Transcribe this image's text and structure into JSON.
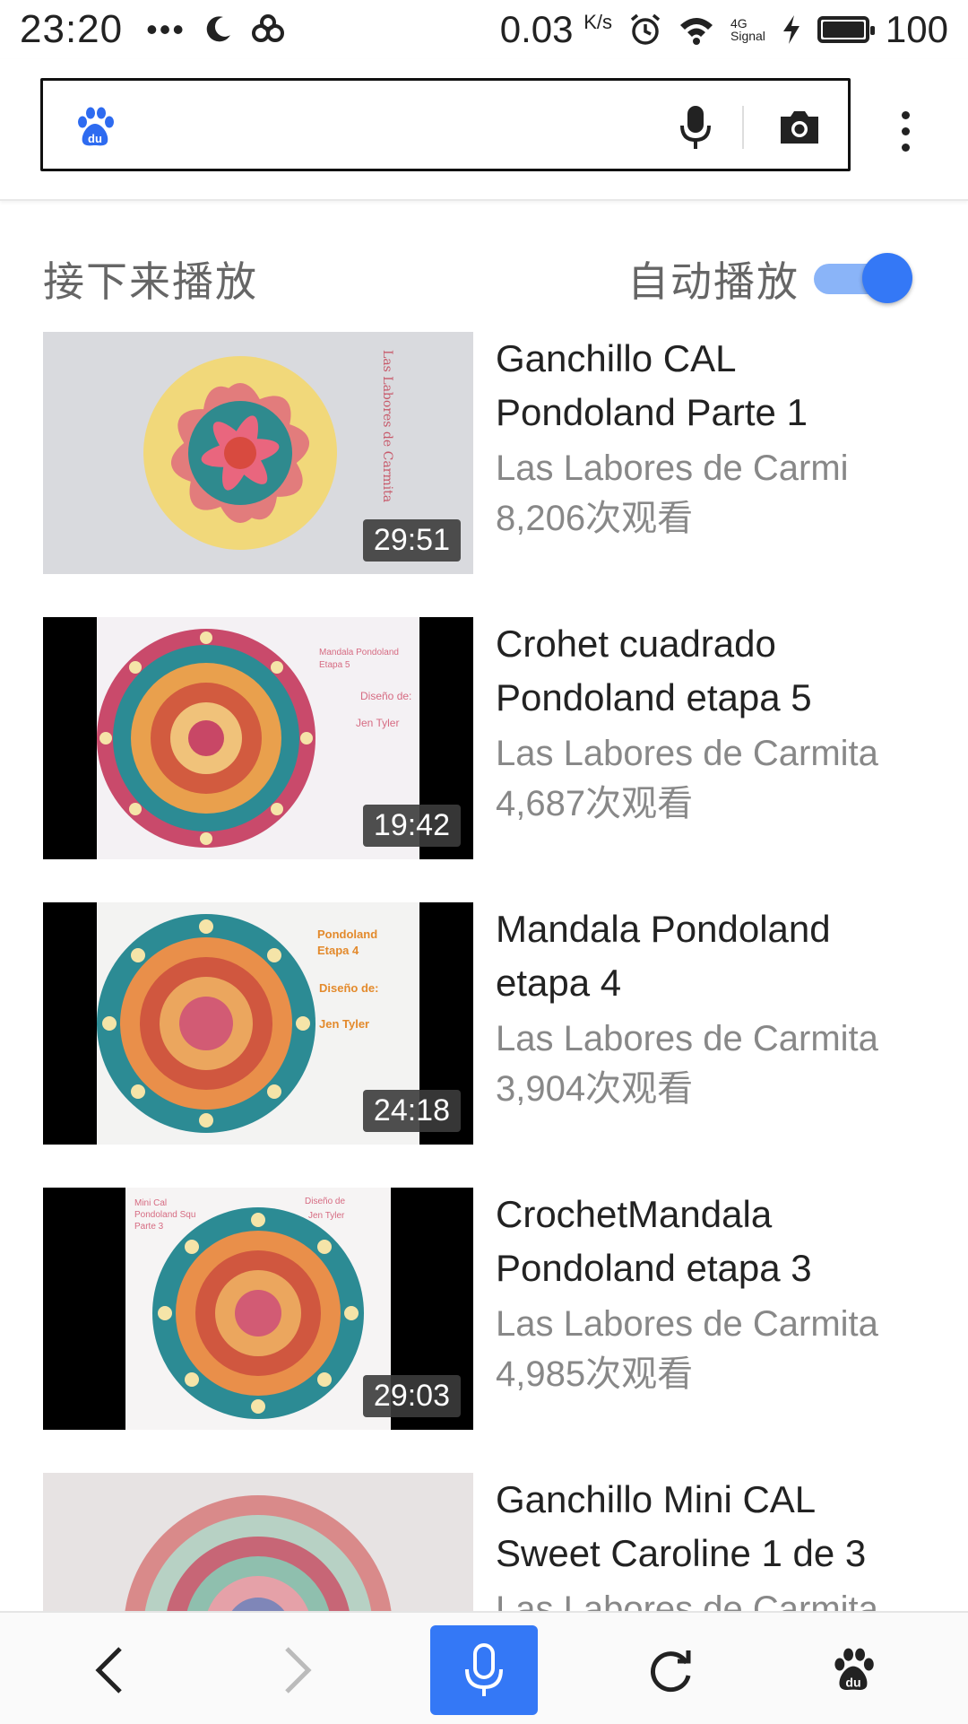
{
  "status_bar": {
    "time": "23:20",
    "dots": "•••",
    "speed": "0.03",
    "speed_unit": "K/s",
    "network": "4G",
    "signal_label": "Signal",
    "battery_pct": "100"
  },
  "search": {
    "placeholder": "",
    "logo_icon": "baidu-paw-icon",
    "mic_icon": "microphone-icon",
    "camera_icon": "camera-icon",
    "more_icon": "more-vert-icon"
  },
  "upnext": {
    "title": "接下来播放",
    "autoplay_label": "自动播放",
    "autoplay_on": true,
    "accent": "#3478f6"
  },
  "videos": [
    {
      "title_line1": "Ganchillo CAL",
      "title_line2": "Pondoland Parte 1",
      "channel": "Las Labores de Carmi",
      "views": "8,206次观看",
      "duration": "29:51"
    },
    {
      "title_line1": "Crohet cuadrado",
      "title_line2": "Pondoland etapa 5",
      "channel": "Las Labores de Carmita",
      "views": "4,687次观看",
      "duration": "19:42"
    },
    {
      "title_line1": "Mandala Pondoland",
      "title_line2": "etapa 4",
      "channel": "Las Labores de Carmita",
      "views": "3,904次观看",
      "duration": "24:18"
    },
    {
      "title_line1": "CrochetMandala",
      "title_line2": "Pondoland etapa 3",
      "channel": "Las Labores de Carmita",
      "views": "4,985次观看",
      "duration": "29:03"
    },
    {
      "title_line1": "Ganchillo Mini CAL",
      "title_line2": "Sweet Caroline 1 de 3",
      "channel": "Las Labores de Carmita",
      "views": "",
      "duration": ""
    }
  ],
  "thumb_text": {
    "v1_side": "Las Labores de Carmita",
    "v2_line1": "Mandala Pondoland",
    "v2_line2": "Etapa 5",
    "v2_line3": "Diseño de:",
    "v2_line4": "Jen Tyler",
    "v3_line1": "Pondoland",
    "v3_line2": "Etapa 4",
    "v3_line3": "Diseño de:",
    "v3_line4": "Jen Tyler",
    "v4_line1": "Mini Cal",
    "v4_line2": "Pondoland Squ",
    "v4_line3": "Parte 3",
    "v4_line4": "Diseño de",
    "v4_line5": "Jen Tyler"
  },
  "bottom_nav": {
    "back_icon": "chevron-left-icon",
    "forward_icon": "chevron-right-icon",
    "voice_icon": "microphone-icon",
    "refresh_icon": "refresh-icon",
    "home_icon": "baidu-paw-icon",
    "voice_bg": "#3478f6"
  }
}
